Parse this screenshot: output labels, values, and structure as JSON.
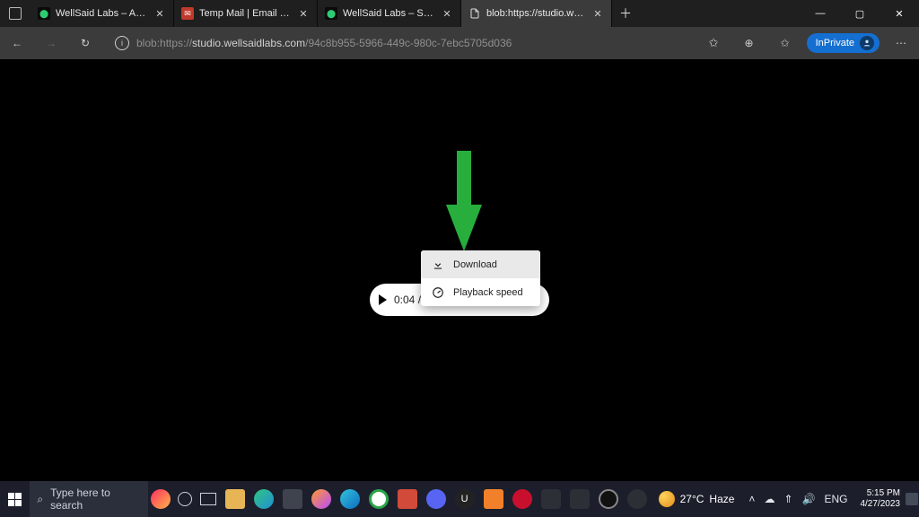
{
  "browser": {
    "tabs": [
      {
        "title": "WellSaid Labs – Account Verificat",
        "favClass": "green"
      },
      {
        "title": "Temp Mail | Email Generator | Te",
        "favClass": "red"
      },
      {
        "title": "WellSaid Labs – Studio",
        "favClass": "green"
      },
      {
        "title": "blob:https://studio.wellsaidlabs.c",
        "favClass": "doc"
      }
    ],
    "active_tab_index": 3,
    "url_dim_prefix": "blob:https://",
    "url_bold": "studio.wellsaidlabs.com",
    "url_dim_suffix": "/94c8b955-5966-449c-980c-7ebc5705d036",
    "inprivate_label": "InPrivate"
  },
  "player": {
    "time": "0:04 /"
  },
  "context_menu": {
    "download": "Download",
    "playback_speed": "Playback speed"
  },
  "taskbar": {
    "search_placeholder": "Type here to search",
    "weather_temp": "27°C",
    "weather_desc": "Haze",
    "time": "5:15 PM",
    "date": "4/27/2023"
  },
  "icons": {
    "nav_back": "←",
    "nav_fwd": "→",
    "reload": "↻",
    "info": "i",
    "star": "✩",
    "ext": "⊕",
    "fav2": "✩",
    "more": "⋯",
    "close": "✕",
    "plus": "＋",
    "min": "—",
    "max": "▢",
    "winclose": "✕",
    "tray_up": "˄",
    "cloud": "☁",
    "wifi": "⇑",
    "vol": "🔊",
    "lang": "ENG",
    "search": "⌕"
  }
}
